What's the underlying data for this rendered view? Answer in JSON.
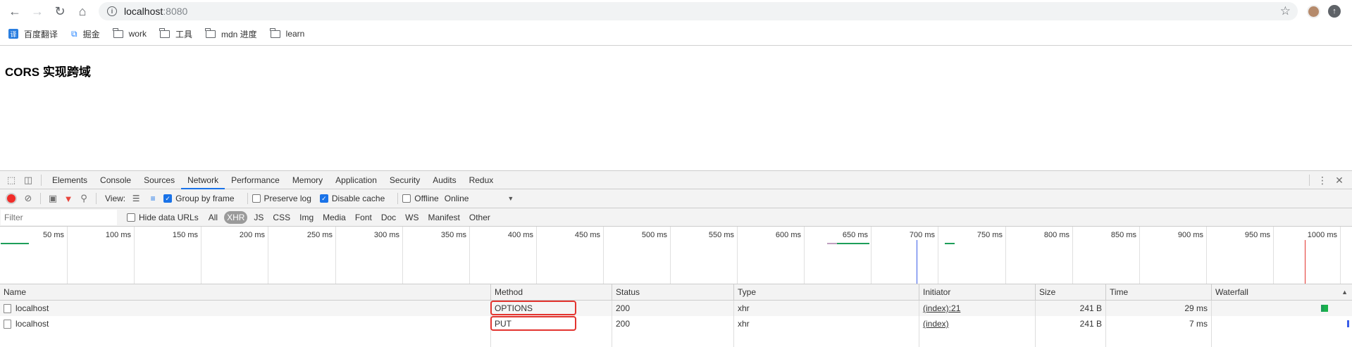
{
  "browser": {
    "url_host": "localhost",
    "url_port": ":8080"
  },
  "bookmarks": [
    {
      "label": "百度翻译",
      "icon": "translate-icon"
    },
    {
      "label": "掘金",
      "icon": "juejin-icon"
    },
    {
      "label": "work",
      "icon": "folder-icon"
    },
    {
      "label": "工具",
      "icon": "folder-icon"
    },
    {
      "label": "mdn 进度",
      "icon": "folder-icon"
    },
    {
      "label": "learn",
      "icon": "folder-icon"
    }
  ],
  "page": {
    "heading": "CORS 实现跨域"
  },
  "devtools": {
    "tabs": [
      "Elements",
      "Console",
      "Sources",
      "Network",
      "Performance",
      "Memory",
      "Application",
      "Security",
      "Audits",
      "Redux"
    ],
    "active_tab": "Network",
    "toolbar": {
      "view_label": "View:",
      "group_by_frame": "Group by frame",
      "group_by_frame_checked": true,
      "preserve_log": "Preserve log",
      "preserve_log_checked": false,
      "disable_cache": "Disable cache",
      "disable_cache_checked": true,
      "offline": "Offline",
      "offline_checked": false,
      "throttle": "Online"
    },
    "filterbar": {
      "placeholder": "Filter",
      "hide_data_urls": "Hide data URLs",
      "types": [
        "All",
        "XHR",
        "JS",
        "CSS",
        "Img",
        "Media",
        "Font",
        "Doc",
        "WS",
        "Manifest",
        "Other"
      ],
      "active_type": "XHR"
    },
    "timeline": {
      "ticks": [
        "50 ms",
        "100 ms",
        "150 ms",
        "200 ms",
        "250 ms",
        "300 ms",
        "350 ms",
        "400 ms",
        "450 ms",
        "500 ms",
        "550 ms",
        "600 ms",
        "650 ms",
        "700 ms",
        "750 ms",
        "800 ms",
        "850 ms",
        "900 ms",
        "950 ms",
        "1000 ms"
      ],
      "dom_content_loaded_color": "#3b5ee8",
      "load_color": "#e3342f"
    },
    "columns": [
      "Name",
      "Method",
      "Status",
      "Type",
      "Initiator",
      "Size",
      "Time",
      "Waterfall"
    ],
    "rows": [
      {
        "name": "localhost",
        "method": "OPTIONS",
        "status": "200",
        "type": "xhr",
        "initiator": "(index):21",
        "size": "241 B",
        "time": "29 ms"
      },
      {
        "name": "localhost",
        "method": "PUT",
        "status": "200",
        "type": "xhr",
        "initiator": "(index)",
        "size": "241 B",
        "time": "7 ms"
      }
    ],
    "highlight_color": "#e3342f"
  }
}
